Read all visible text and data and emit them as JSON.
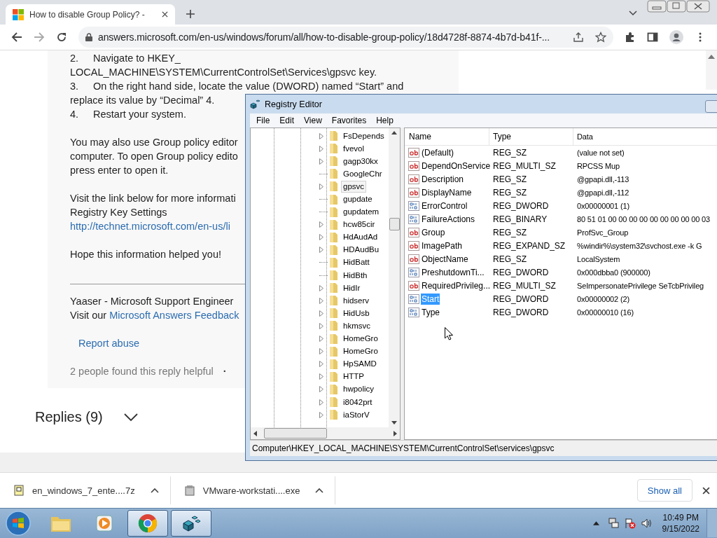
{
  "browser": {
    "tab": {
      "title": "How to disable Group Policy? -"
    },
    "url": "answers.microsoft.com/en-us/windows/forum/all/how-to-disable-group-policy/18d4728f-8874-4b7d-b41f-..."
  },
  "article": {
    "blocks": [
      {
        "kind": "step",
        "number": "2.",
        "lines": [
          {
            "text": "Navigate to HKEY_",
            "link": false
          },
          {
            "text": "LOCAL_MACHINE\\SYSTEM\\CurrentControlSet\\Services\\gpsvc key.",
            "link": false
          }
        ]
      },
      {
        "kind": "step",
        "number": "3.",
        "lines": [
          {
            "text": "On the right hand side, locate the value (DWORD) named “Start” and",
            "link": false
          },
          {
            "text": "replace its value by “Decimal” 4.",
            "link": false
          }
        ]
      },
      {
        "kind": "step",
        "number": "4.",
        "lines": [
          {
            "text": "Restart your system.",
            "link": false
          }
        ]
      },
      {
        "kind": "paragraph",
        "lines": [
          {
            "text": "You may also use Group policy editor",
            "link": false
          },
          {
            "text": "computer. To open Group policy edito",
            "link": false
          },
          {
            "text": "press enter to open it.",
            "link": false
          }
        ]
      },
      {
        "kind": "paragraph",
        "lines": [
          {
            "text": "Visit the link below for more informati",
            "link": false
          },
          {
            "text": "Registry Key Settings",
            "link": false
          },
          {
            "text": "http://technet.microsoft.com/en-us/li",
            "link": true
          }
        ]
      },
      {
        "kind": "paragraph",
        "lines": [
          {
            "text": "Hope this information helped you!",
            "link": false
          }
        ]
      }
    ],
    "signature": {
      "name": "Yaaser - Microsoft Support Engineer",
      "visit_prefix": "Visit our",
      "visit_link": "Microsoft Answers Feedback"
    },
    "report_link": "Report abuse",
    "helpful": "2 people found this reply helpful",
    "separator": "·"
  },
  "replies": {
    "label": "Replies (9)",
    "expanded": false
  },
  "regedit": {
    "title": "Registry Editor",
    "menu": [
      "File",
      "Edit",
      "View",
      "Favorites",
      "Help"
    ],
    "tree": [
      {
        "label": "FsDepends",
        "expandable": true,
        "selected": false
      },
      {
        "label": "fvevol",
        "expandable": true,
        "selected": false
      },
      {
        "label": "gagp30kx",
        "expandable": true,
        "selected": false
      },
      {
        "label": "GoogleChr",
        "expandable": false,
        "selected": false
      },
      {
        "label": "gpsvc",
        "expandable": true,
        "selected": true
      },
      {
        "label": "gupdate",
        "expandable": false,
        "selected": false
      },
      {
        "label": "gupdatem",
        "expandable": false,
        "selected": false
      },
      {
        "label": "hcw85cir",
        "expandable": true,
        "selected": false
      },
      {
        "label": "HdAudAd",
        "expandable": true,
        "selected": false
      },
      {
        "label": "HDAudBu",
        "expandable": true,
        "selected": false
      },
      {
        "label": "HidBatt",
        "expandable": false,
        "selected": false
      },
      {
        "label": "HidBth",
        "expandable": false,
        "selected": false
      },
      {
        "label": "HidIr",
        "expandable": true,
        "selected": false
      },
      {
        "label": "hidserv",
        "expandable": true,
        "selected": false
      },
      {
        "label": "HidUsb",
        "expandable": true,
        "selected": false
      },
      {
        "label": "hkmsvc",
        "expandable": true,
        "selected": false
      },
      {
        "label": "HomeGro",
        "expandable": true,
        "selected": false
      },
      {
        "label": "HomeGro",
        "expandable": true,
        "selected": false
      },
      {
        "label": "HpSAMD",
        "expandable": true,
        "selected": false
      },
      {
        "label": "HTTP",
        "expandable": true,
        "selected": false
      },
      {
        "label": "hwpolicy",
        "expandable": true,
        "selected": false
      },
      {
        "label": "i8042prt",
        "expandable": true,
        "selected": false
      },
      {
        "label": "iaStorV",
        "expandable": true,
        "selected": false
      }
    ],
    "columns": [
      "Name",
      "Type",
      "Data"
    ],
    "values": [
      {
        "kind": "string",
        "name": "(Default)",
        "type": "REG_SZ",
        "data": "(value not set)",
        "selected": false
      },
      {
        "kind": "string",
        "name": "DependOnService",
        "type": "REG_MULTI_SZ",
        "data": "RPCSS Mup",
        "selected": false
      },
      {
        "kind": "string",
        "name": "Description",
        "type": "REG_SZ",
        "data": "@gpapi.dll,-113",
        "selected": false
      },
      {
        "kind": "string",
        "name": "DisplayName",
        "type": "REG_SZ",
        "data": "@gpapi.dll,-112",
        "selected": false
      },
      {
        "kind": "binary",
        "name": "ErrorControl",
        "type": "REG_DWORD",
        "data": "0x00000001 (1)",
        "selected": false
      },
      {
        "kind": "binary",
        "name": "FailureActions",
        "type": "REG_BINARY",
        "data": "80 51 01 00 00 00 00 00 00 00 00 00 03",
        "selected": false
      },
      {
        "kind": "string",
        "name": "Group",
        "type": "REG_SZ",
        "data": "ProfSvc_Group",
        "selected": false
      },
      {
        "kind": "string",
        "name": "ImagePath",
        "type": "REG_EXPAND_SZ",
        "data": "%windir%\\system32\\svchost.exe -k G",
        "selected": false
      },
      {
        "kind": "string",
        "name": "ObjectName",
        "type": "REG_SZ",
        "data": "LocalSystem",
        "selected": false
      },
      {
        "kind": "binary",
        "name": "PreshutdownTi...",
        "type": "REG_DWORD",
        "data": "0x000dbba0 (900000)",
        "selected": false
      },
      {
        "kind": "string",
        "name": "RequiredPrivileg...",
        "type": "REG_MULTI_SZ",
        "data": "SeImpersonatePrivilege SeTcbPrivileg",
        "selected": false
      },
      {
        "kind": "binary",
        "name": "Start",
        "type": "REG_DWORD",
        "data": "0x00000002 (2)",
        "selected": true
      },
      {
        "kind": "binary",
        "name": "Type",
        "type": "REG_DWORD",
        "data": "0x00000010 (16)",
        "selected": false
      }
    ],
    "status": "Computer\\HKEY_LOCAL_MACHINE\\SYSTEM\\CurrentControlSet\\services\\gpsvc"
  },
  "downloads": {
    "items": [
      {
        "kind": "archive",
        "name": "en_windows_7_ente....7z"
      },
      {
        "kind": "installer",
        "name": "VMware-workstati....exe"
      }
    ],
    "show_all": "Show all"
  },
  "taskbar": {
    "apps": [
      {
        "kind": "explorer",
        "active": false
      },
      {
        "kind": "media",
        "active": false
      },
      {
        "kind": "chrome",
        "active": true
      },
      {
        "kind": "regedit",
        "active": true
      }
    ],
    "time": "10:49 PM",
    "date": "9/15/2022"
  }
}
